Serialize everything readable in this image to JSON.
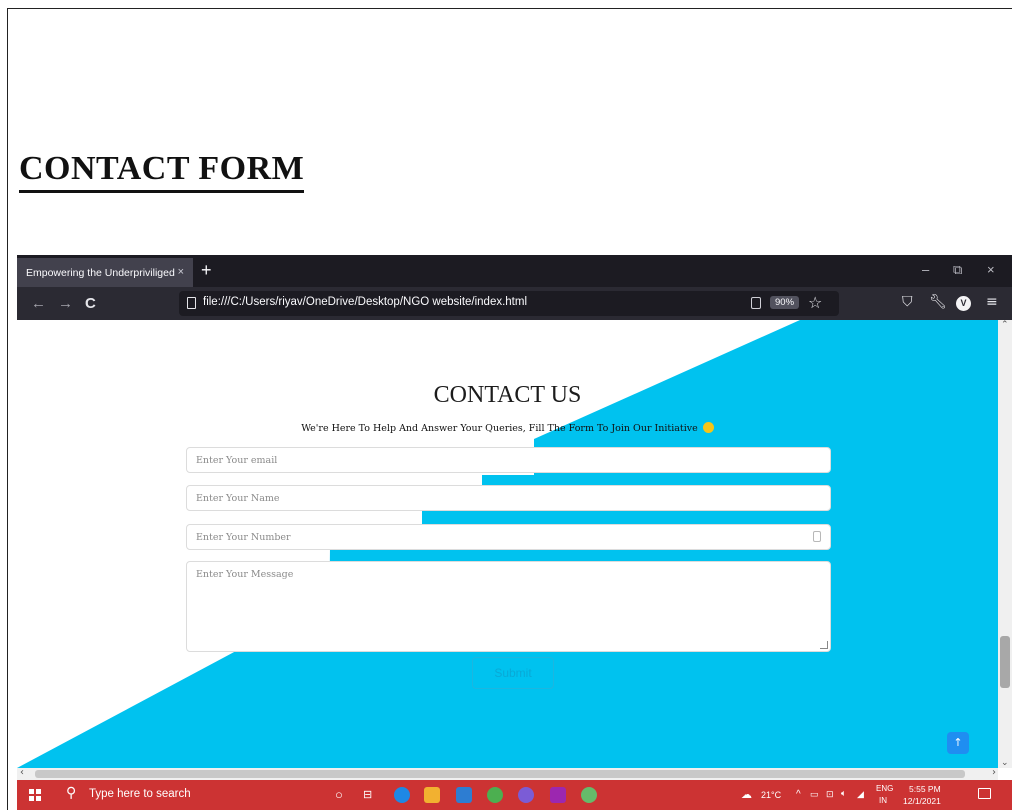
{
  "document": {
    "heading": "CONTACT FORM"
  },
  "browser": {
    "tab_title": "Empowering the Underpriviliged",
    "tab_close": "×",
    "new_tab": "+",
    "window_controls": {
      "minimize": "–",
      "restore": "⧉",
      "close": "×"
    },
    "nav": {
      "back": "←",
      "forward": "→",
      "reload": "C"
    },
    "url": "file:///C:/Users/riyav/OneDrive/Desktop/NGO website/index.html",
    "zoom": "90%",
    "avatar_letter": "V"
  },
  "page": {
    "title": "CONTACT US",
    "subtitle": "We're Here To Help And Answer Your Queries, Fill The Form To Join Our Initiative",
    "form": {
      "email_placeholder": "Enter Your email",
      "name_placeholder": "Enter Your Name",
      "number_placeholder": "Enter Your Number",
      "message_placeholder": "Enter Your Message",
      "submit_label": "Submit"
    },
    "scroll_top_icon": "↑"
  },
  "taskbar": {
    "search_placeholder": "Type here to search",
    "weather": "21°C",
    "language_top": "ENG",
    "language_bottom": "IN",
    "time": "5:55 PM",
    "date": "12/1/2021"
  },
  "colors": {
    "accent": "#00c2ef",
    "browser_dark": "#1c1b22",
    "taskbar": "#cc3333"
  }
}
